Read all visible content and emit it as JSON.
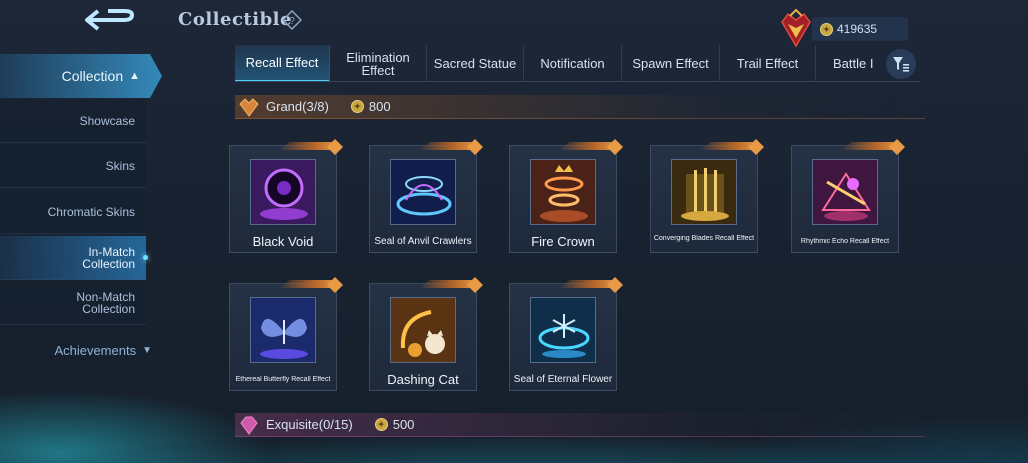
{
  "header": {
    "title": "Collectible",
    "currency_value": "419635"
  },
  "sidebar": {
    "collection_label": "Collection",
    "items": [
      {
        "label": "Showcase"
      },
      {
        "label": "Skins"
      },
      {
        "label": "Chromatic Skins"
      },
      {
        "label_line1": "In-Match",
        "label_line2": "Collection",
        "active": true
      },
      {
        "label_line1": "Non-Match",
        "label_line2": "Collection"
      }
    ],
    "achievements_label": "Achievements"
  },
  "tabs": [
    {
      "label": "Recall Effect",
      "active": true
    },
    {
      "label_line1": "Elimination",
      "label_line2": "Effect"
    },
    {
      "label": "Sacred Statue"
    },
    {
      "label": "Notification"
    },
    {
      "label": "Spawn Effect"
    },
    {
      "label": "Trail Effect"
    },
    {
      "label": "Battle I"
    }
  ],
  "sections": {
    "grand": {
      "label": "Grand(3/8)",
      "price": "800"
    },
    "exquisite": {
      "label": "Exquisite(0/15)",
      "price": "500"
    }
  },
  "cards": [
    {
      "name": "Black Void"
    },
    {
      "name": "Seal of Anvil Crawlers"
    },
    {
      "name": "Fire Crown"
    },
    {
      "name": "Converging Blades Recall Effect"
    },
    {
      "name": "Rhythmic Echo Recall Effect"
    },
    {
      "name": "Ethereal Butterfly Recall Effect"
    },
    {
      "name": "Dashing Cat"
    },
    {
      "name": "Seal of Eternal Flower"
    }
  ],
  "colors": {
    "accent_cyan": "#4fd0f0",
    "grand_orange": "#d8843a",
    "exquisite_pink": "#d05aa8",
    "coin_gold": "#c9a642"
  }
}
